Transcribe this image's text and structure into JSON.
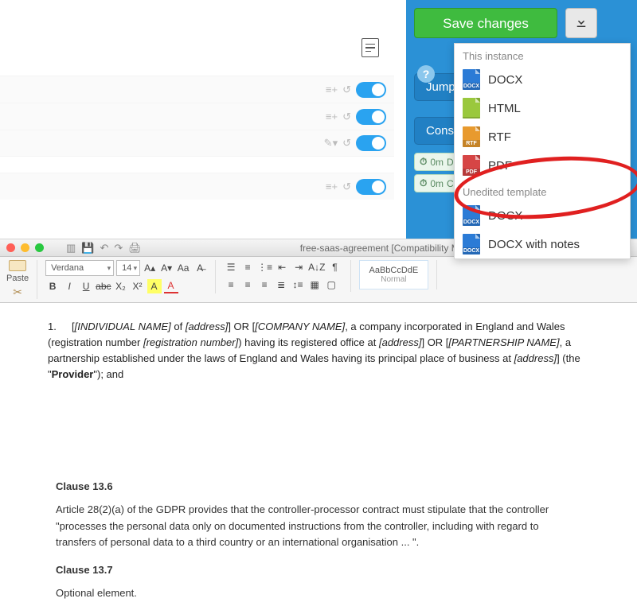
{
  "editor": {
    "save_label": "Save changes",
    "help_tooltip": "?",
    "jump_btn": "Jump to",
    "considerations_btn": "Considerations",
    "pills": [
      {
        "time": "0m",
        "text": "Download"
      },
      {
        "time": "0m",
        "text": "Cross-references and definitions"
      }
    ]
  },
  "download_menu": {
    "section1": "This instance",
    "items1": [
      {
        "icon": "docx",
        "label": "DOCX"
      },
      {
        "icon": "html",
        "label": "HTML"
      },
      {
        "icon": "rtf",
        "label": "RTF"
      },
      {
        "icon": "pdf",
        "label": "PDF"
      }
    ],
    "section2": "Unedited template",
    "items2": [
      {
        "icon": "docx",
        "label": "DOCX"
      },
      {
        "icon": "docx",
        "label": "DOCX with notes"
      }
    ]
  },
  "word": {
    "title": "free-saas-agreement [Compatibility Mode]",
    "paste_label": "Paste",
    "font_name": "Verdana",
    "font_size": "14",
    "style_sample": "AaBbCcDdE",
    "style_name": "Normal",
    "paragraph_num": "1.",
    "paragraph_html": "[<span class=\"ph\">[INDIVIDUAL NAME]</span> of <span class=\"ph\">[address]</span>] OR [<span class=\"ph\">[COMPANY NAME]</span>, a company incorporated in England and Wales (registration number <span class=\"ph\">[registration number]</span>) having its registered office at <span class=\"ph\">[address]</span>] OR [<span class=\"ph\">[PARTNERSHIP NAME]</span>, a partnership established under the laws of England and Wales having its principal place of business at <span class=\"ph\">[address]</span>] (the \"<b>Provider</b>\"); and"
  },
  "notes": {
    "h1": "Clause 13.6",
    "p1": "Article 28(2)(a) of the GDPR provides that the controller-processor contract must stipulate that the controller \"processes the personal data only on documented instructions from the controller, including with regard to transfers of personal data to a third country or an international organisation ... \".",
    "h2": "Clause 13.7",
    "p2": "Optional element."
  }
}
